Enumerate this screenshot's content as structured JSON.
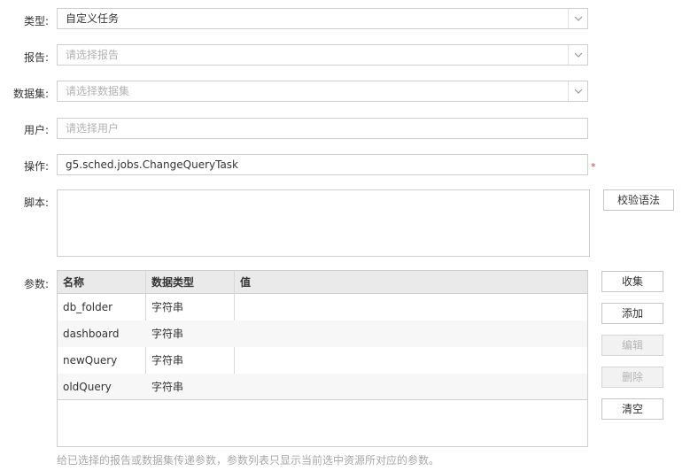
{
  "form": {
    "type": {
      "label": "类型:",
      "value": "自定义任务"
    },
    "report": {
      "label": "报告:",
      "placeholder": "请选择报告"
    },
    "dataset": {
      "label": "数据集:",
      "placeholder": "请选择数据集"
    },
    "user": {
      "label": "用户:",
      "placeholder": "请选择用户"
    },
    "operation": {
      "label": "操作:",
      "value": "g5.sched.jobs.ChangeQueryTask",
      "required_mark": "*"
    },
    "script": {
      "label": "脚本:",
      "value": "",
      "validate_button": "校验语法"
    },
    "params_label": "参数:"
  },
  "params_table": {
    "columns": [
      "名称",
      "数据类型",
      "值"
    ],
    "rows": [
      {
        "name": "db_folder",
        "type": "字符串",
        "value": ""
      },
      {
        "name": "dashboard",
        "type": "字符串",
        "value": ""
      },
      {
        "name": "newQuery",
        "type": "字符串",
        "value": ""
      },
      {
        "name": "oldQuery",
        "type": "字符串",
        "value": ""
      }
    ]
  },
  "param_buttons": {
    "collect": "收集",
    "add": "添加",
    "edit": "编辑",
    "delete": "删除",
    "clear": "清空"
  },
  "hint": "给已选择的报告或数据集传递参数，参数列表只显示当前选中资源所对应的参数。"
}
